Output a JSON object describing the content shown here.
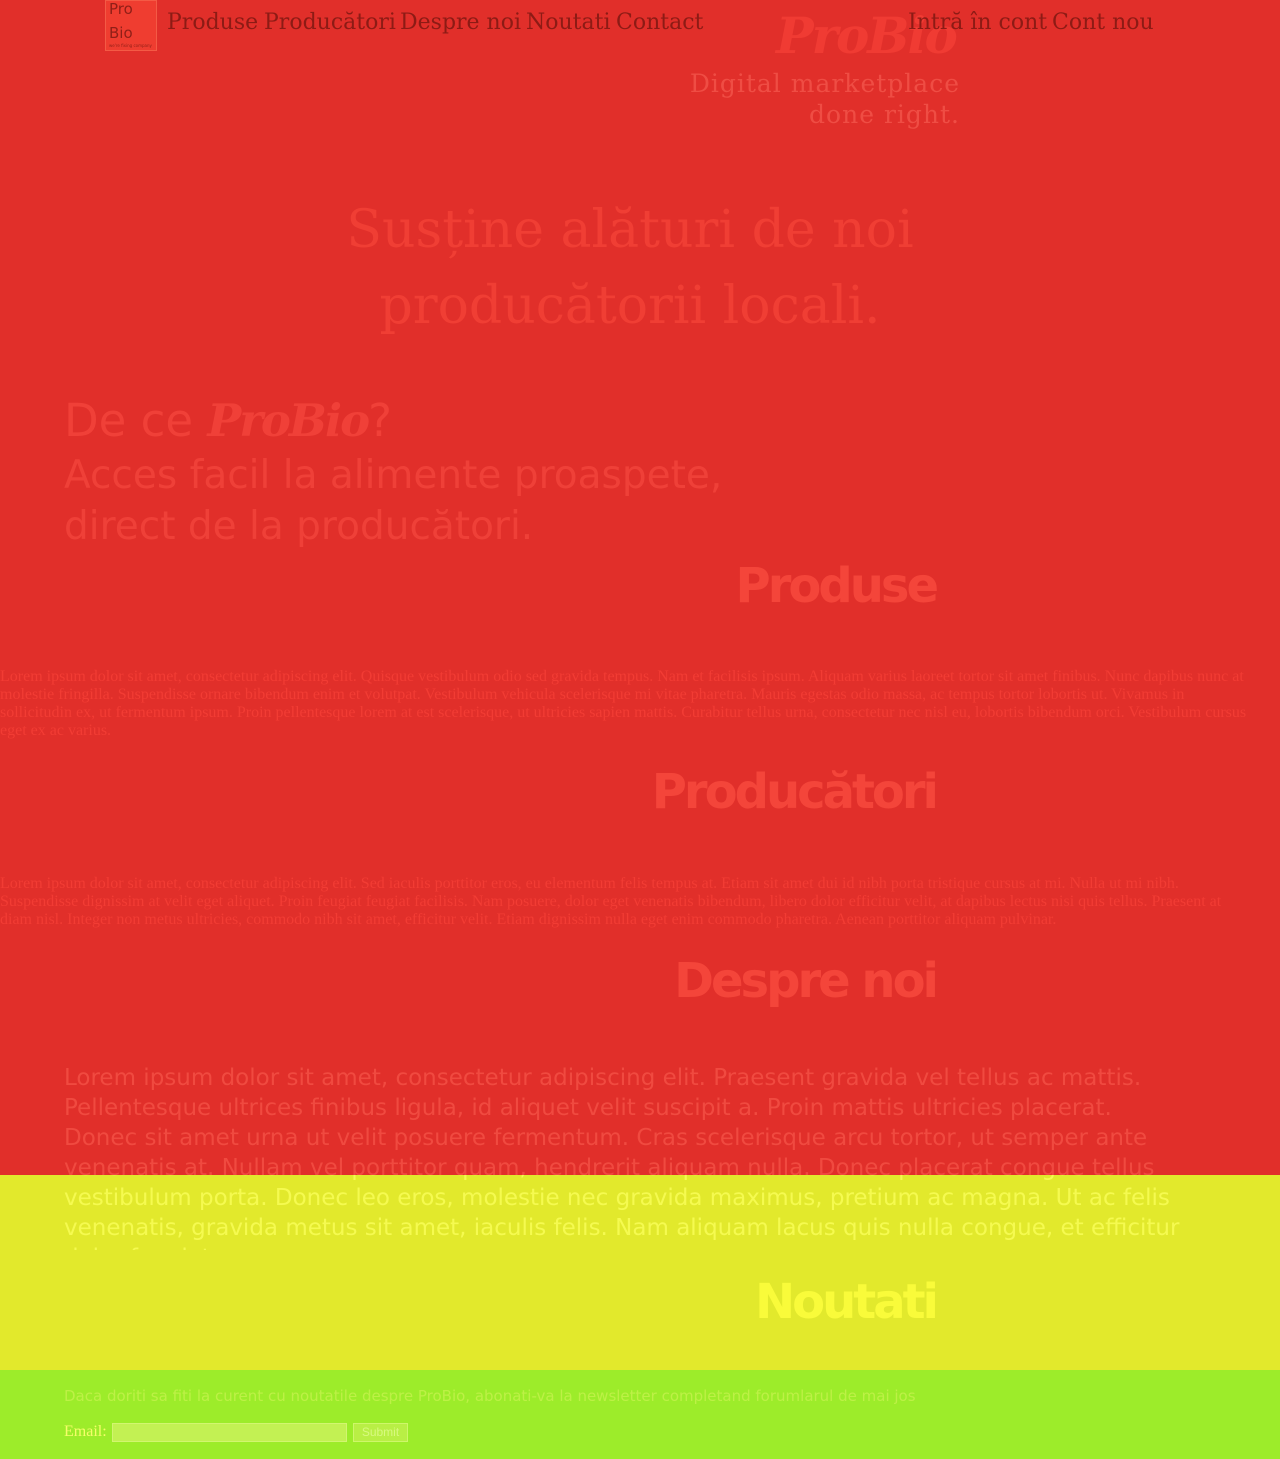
{
  "logo": {
    "line1": "Pro",
    "line2": "Bio",
    "tagline": "we're fixing company"
  },
  "nav": {
    "left": [
      "Produse",
      "Producători",
      "Despre noi",
      "Noutati",
      "Contact"
    ],
    "login": "Intră în cont",
    "signup": "Cont nou"
  },
  "brand": {
    "name": "ProBio",
    "tagline_line1": "Digital marketplace",
    "tagline_line2": "done right."
  },
  "hero": {
    "line1": "Susține alături de noi",
    "line2": "producătorii locali."
  },
  "why": {
    "prefix": "De ce ",
    "brand": "ProBio",
    "suffix": "?",
    "line1": "Acces facil la alimente proaspete,",
    "line2": "direct de la producători."
  },
  "sections": {
    "produse": {
      "title": "Produse",
      "text": "Lorem ipsum dolor sit amet, consectetur adipiscing elit. Quisque vestibulum odio sed gravida tempus. Nam et facilisis ipsum. Aliquam varius laoreet tortor sit amet finibus. Nunc dapibus nunc at molestie fringilla. Suspendisse ornare bibendum enim et volutpat. Vestibulum vehicula scelerisque mi vitae pharetra. Mauris egestas odio massa, ac tempus tortor lobortis ut. Vivamus in sollicitudin ex, ut fermentum ipsum. Proin pellentesque lorem at est scelerisque, ut ultricies sapien mattis. Curabitur tellus urna, consectetur nec nisl eu, lobortis bibendum orci. Vestibulum cursus eget ex ac varius."
    },
    "producatori": {
      "title": "Producători",
      "text": "Lorem ipsum dolor sit amet, consectetur adipiscing elit. Sed iaculis porttitor eros, eu elementum felis tempus at. Etiam sit amet dui id nibh porta tristique cursus at mi. Nulla ut mi nibh. Suspendisse dignissim at velit eget aliquet. Proin feugiat feugiat facilisis. Nam posuere, dolor eget venenatis bibendum, libero dolor efficitur velit, at dapibus lectus nisi quis tellus. Praesent at diam nisl. Integer non metus ultricies, commodo nibh sit amet, efficitur velit. Etiam dignissim nulla eget enim commodo pharetra. Aenean porttitor aliquam pulvinar."
    },
    "despre": {
      "title": "Despre noi",
      "text": "Lorem ipsum dolor sit amet, consectetur adipiscing elit. Praesent gravida vel tellus ac mattis. Pellentesque ultrices finibus ligula, id aliquet velit suscipit a. Proin mattis ultricies placerat. Donec sit amet urna ut velit posuere fermentum. Cras scelerisque arcu tortor, ut semper ante venenatis at. Nullam vel porttitor quam, hendrerit aliquam nulla. Donec placerat congue tellus vestibulum porta. Donec leo eros, molestie nec gravida maximus, pretium ac magna. Ut ac felis venenatis, gravida metus sit amet, iaculis felis. Nam aliquam lacus quis nulla congue, et efficitur dolor feugiat."
    },
    "noutati": {
      "title": "Noutati"
    }
  },
  "newsletter": {
    "text": "Daca doriti sa fiti la curent cu noutatile despre ProBio, abonati-va la newsletter completand forumlarul de mai jos",
    "email_label": "Email:",
    "email_value": "",
    "submit_label": "Submit"
  },
  "colors": {
    "red_band": "#e12f2a",
    "yellow_band": "#e2e92c",
    "green_band": "#9dec2a"
  }
}
